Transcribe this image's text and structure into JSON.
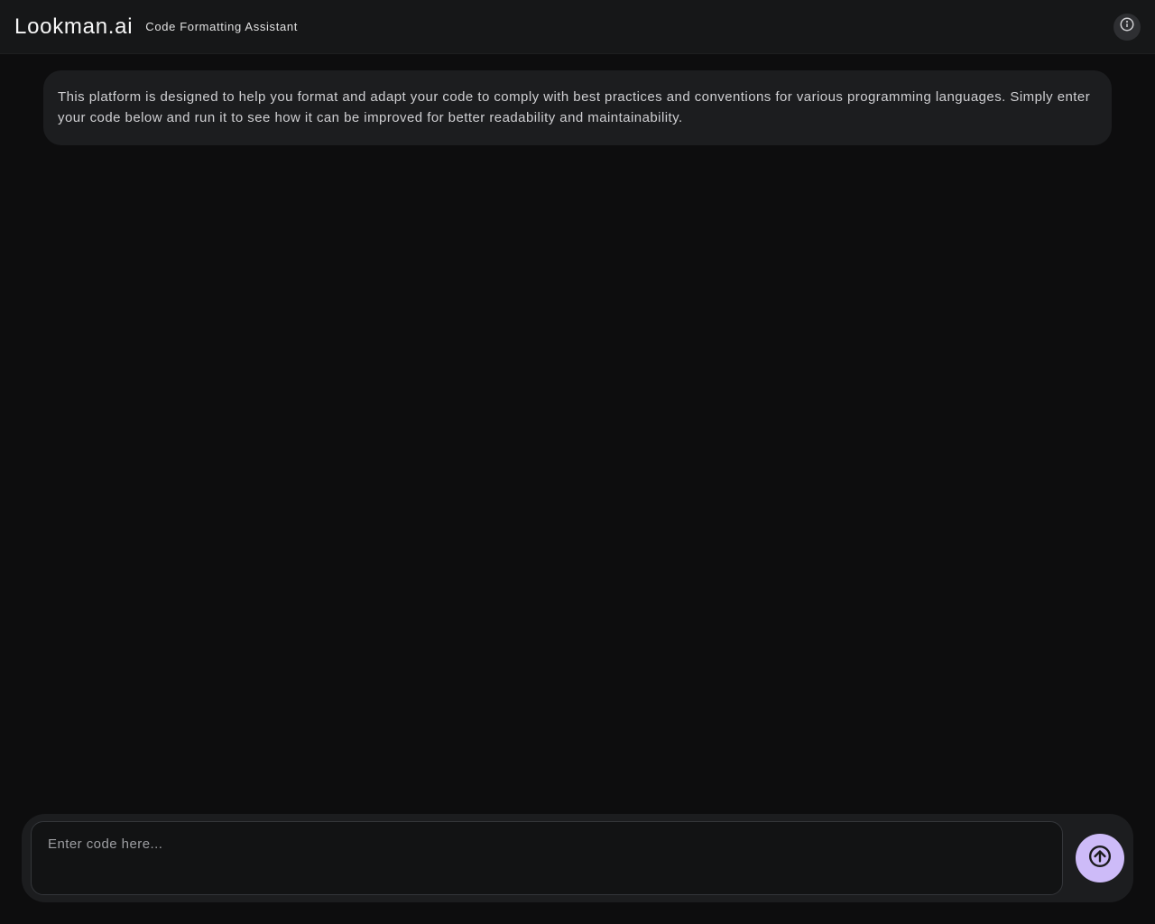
{
  "header": {
    "brand": "Lookman.ai",
    "subtitle": "Code Formatting Assistant"
  },
  "main": {
    "intro": "This platform is designed to help you format and adapt your code to comply with best practices and conventions for various programming languages. Simply enter your code below and run it to see how it can be improved for better readability and maintainability."
  },
  "input": {
    "placeholder": "Enter code here...",
    "value": ""
  },
  "icons": {
    "info": "info-icon",
    "send": "arrow-up-icon"
  },
  "colors": {
    "accent": "#cdbbf8",
    "surface": "#1c1d1f",
    "background": "#0d0d0e"
  }
}
